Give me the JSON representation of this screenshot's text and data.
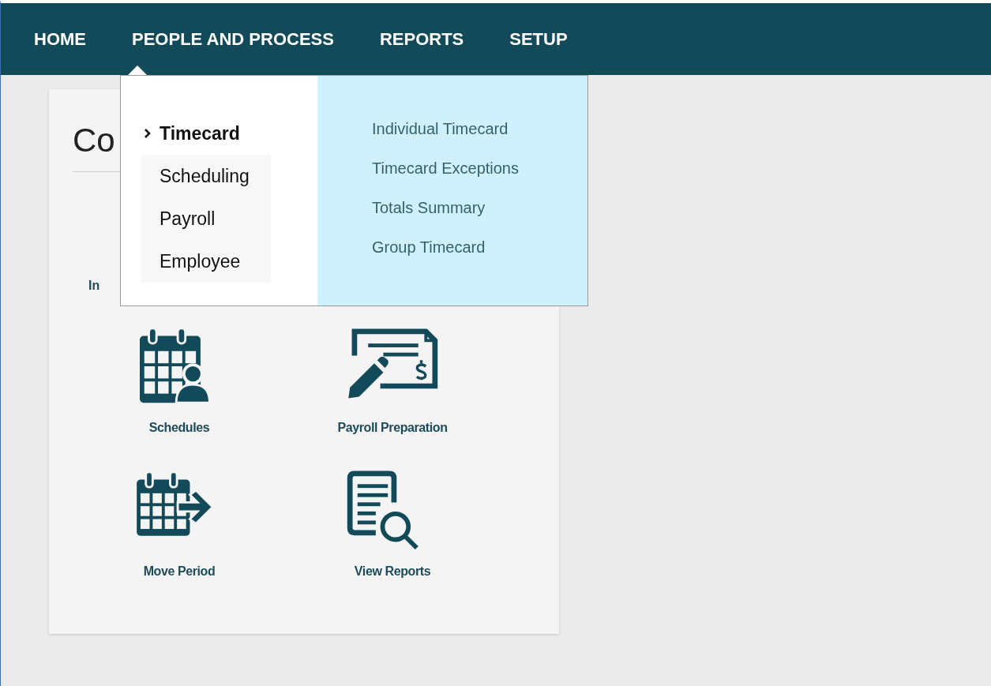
{
  "nav": [
    {
      "label": "HOME",
      "selected": false
    },
    {
      "label": "PEOPLE AND PROCESS",
      "selected": true
    },
    {
      "label": "REPORTS",
      "selected": false
    },
    {
      "label": "SETUP",
      "selected": false
    }
  ],
  "menu": {
    "categories": [
      {
        "label": "Timecard",
        "selected": true
      },
      {
        "label": "Scheduling",
        "selected": false
      },
      {
        "label": "Payroll",
        "selected": false
      },
      {
        "label": "Employee",
        "selected": false
      }
    ],
    "links": [
      "Individual Timecard",
      "Timecard Exceptions",
      "Totals Summary",
      "Group Timecard"
    ]
  },
  "card": {
    "title": "Co",
    "covered_label": "In",
    "tiles": [
      {
        "label": "Schedules",
        "kind": "calendar-person"
      },
      {
        "label": "Payroll Preparation",
        "kind": "check"
      },
      {
        "label": "Move Period",
        "kind": "calendar-arrow"
      },
      {
        "label": "View Reports",
        "kind": "document-search"
      }
    ]
  }
}
